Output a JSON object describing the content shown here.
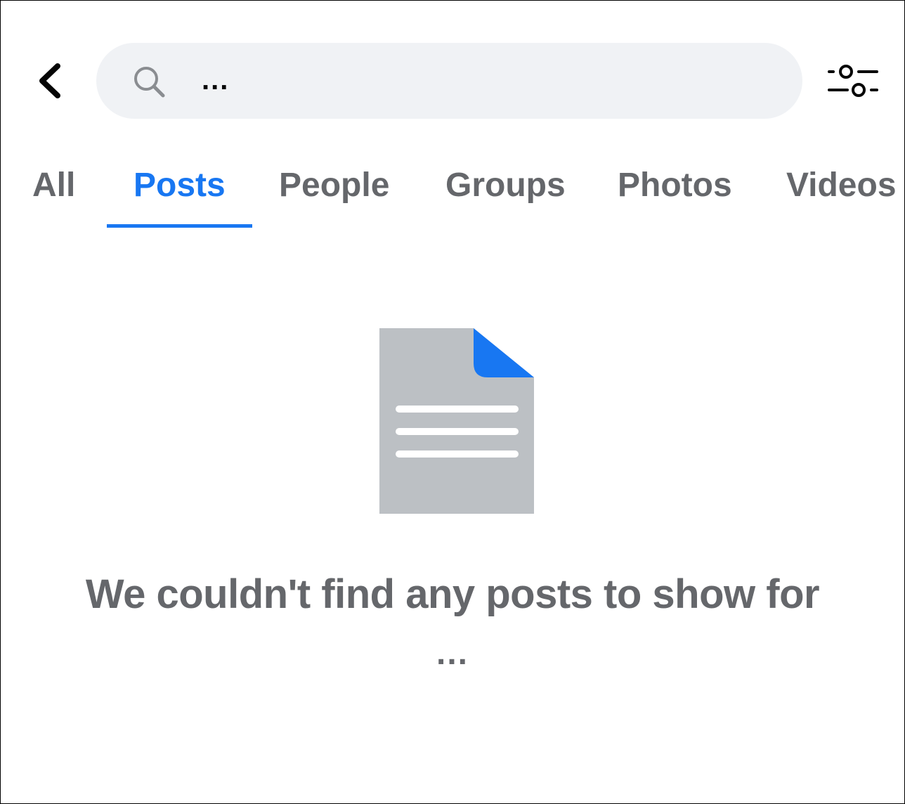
{
  "header": {
    "back_icon": "chevron-left-icon",
    "search": {
      "icon": "search-icon",
      "value": "..."
    },
    "filter_icon": "sliders-icon"
  },
  "tabs": [
    {
      "label": "All",
      "active": false
    },
    {
      "label": "Posts",
      "active": true
    },
    {
      "label": "People",
      "active": false
    },
    {
      "label": "Groups",
      "active": false
    },
    {
      "label": "Photos",
      "active": false
    },
    {
      "label": "Videos",
      "active": false
    }
  ],
  "empty_state": {
    "illustration": "document-icon",
    "title": "We couldn't find any posts to show for",
    "query": "..."
  },
  "colors": {
    "accent": "#1877f2",
    "secondary_text": "#65676b",
    "search_bg": "#f0f2f5",
    "illustration_gray": "#bcc0c4"
  }
}
